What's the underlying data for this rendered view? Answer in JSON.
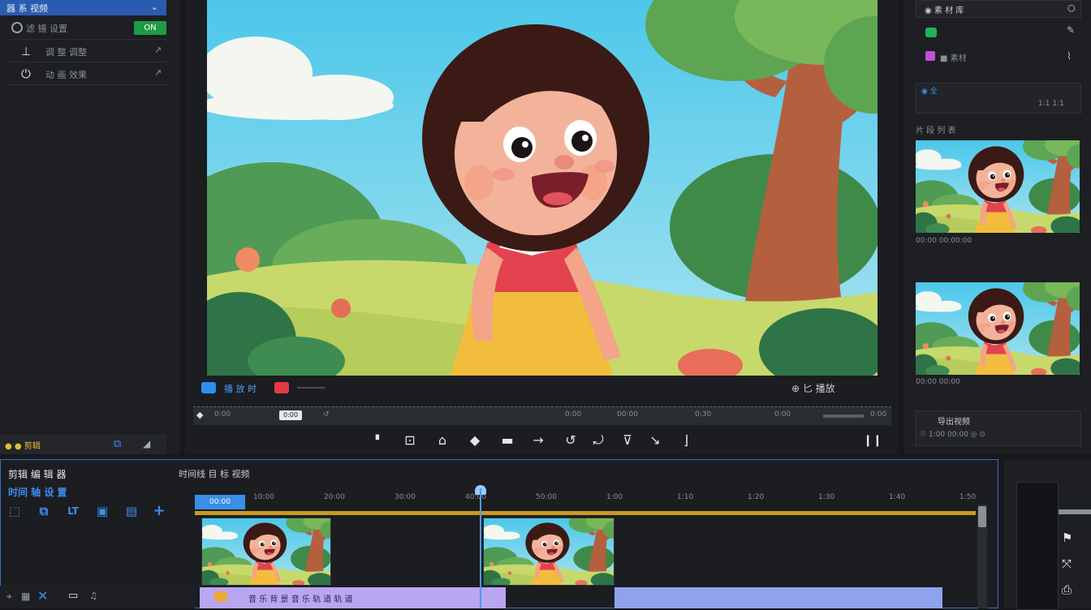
{
  "left_panel": {
    "header_label": "器 系 视频",
    "header_chevron": "⌄",
    "rows": [
      {
        "label": "滤 镜 设置",
        "badge": "ON"
      },
      {
        "label": "调 整 调整"
      },
      {
        "label": "动 画 效果"
      }
    ],
    "status": {
      "text": "● ● 剪辑",
      "btn1": "⧉",
      "btn2": "◢"
    }
  },
  "viewer": {
    "timecode_label": "播 放 时",
    "right_label": "⊕ 匕 播放",
    "controls": [
      "▘",
      "⊡",
      "⌂",
      "◆",
      "▬",
      "→",
      "↺",
      "⤾",
      "⊽",
      "↘",
      "⌋",
      "❙❙"
    ],
    "scrub_labels": [
      "◆",
      "0:00",
      "0:00",
      "↺",
      "0:00",
      "00:00",
      "0:30",
      "0:00",
      "0:00"
    ]
  },
  "right_panel": {
    "top_label": "◉ 素 材 库",
    "row1_icon": "●",
    "row2_label": "■ 素材",
    "field_label": "◉ 全",
    "field_value": "1:1 1:1",
    "section_label": "片 段 列 表",
    "thumb1_caption": "00:00 00:00:00",
    "thumb2_caption": "00:00 00:00",
    "footer_label": "导出视频",
    "footer_values": "☉ 1:00 00:00  ◎  ⊙"
  },
  "timeline": {
    "title": "剪辑 编 辑 器",
    "subtitle": "时间 轴 设 置",
    "track_header": "时间线 目 标 视频",
    "tools": [
      "⬚",
      "⧉",
      "LT",
      "▣",
      "▤",
      "+"
    ],
    "ruler_labels": [
      "00:00",
      "10:00",
      "20:00",
      "30:00",
      "40:00",
      "50:00",
      "1:00",
      "1:10",
      "1:20",
      "1:30",
      "1:40",
      "1:50"
    ],
    "ruler_start_label": "00:00",
    "audio_label": "音 乐 背 景 音 乐 轨 道 轨 道",
    "bottom_tools": [
      "⌖",
      "▦",
      "✕",
      "▭",
      "♫"
    ]
  },
  "colors": {
    "accent_blue": "#2b5bb0",
    "badge_green": "#1f9a46",
    "sky": "#6fd0ea",
    "audio_purple": "#b9a6f0",
    "audio_blue": "#8fa2ee"
  }
}
